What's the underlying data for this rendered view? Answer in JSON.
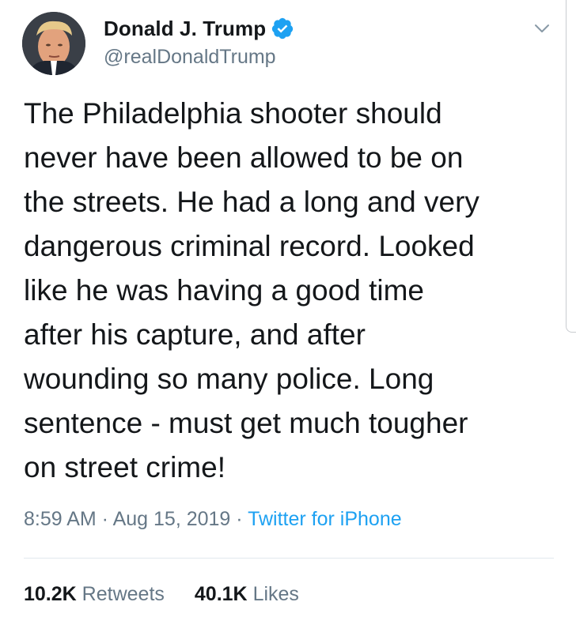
{
  "user": {
    "display_name": "Donald J. Trump",
    "handle": "@realDonaldTrump",
    "verified_icon": "verified-badge-icon",
    "menu_icon": "chevron-down-icon"
  },
  "tweet": {
    "text": "The Philadelphia shooter should\nnever have been allowed to be on\nthe streets. He had a long and very\ndangerous criminal record. Looked\nlike he was having a good time\nafter his capture, and after\nwounding so many police. Long\nsentence - must get much tougher\non street crime!"
  },
  "meta": {
    "time": "8:59 AM",
    "sep1": " · ",
    "date": "Aug 15, 2019",
    "sep2": " · ",
    "source": "Twitter for iPhone"
  },
  "stats": {
    "retweets_count": "10.2K",
    "retweets_label": "Retweets",
    "likes_count": "40.1K",
    "likes_label": "Likes"
  },
  "colors": {
    "text": "#14171a",
    "muted": "#657786",
    "accent": "#1da1f2"
  }
}
